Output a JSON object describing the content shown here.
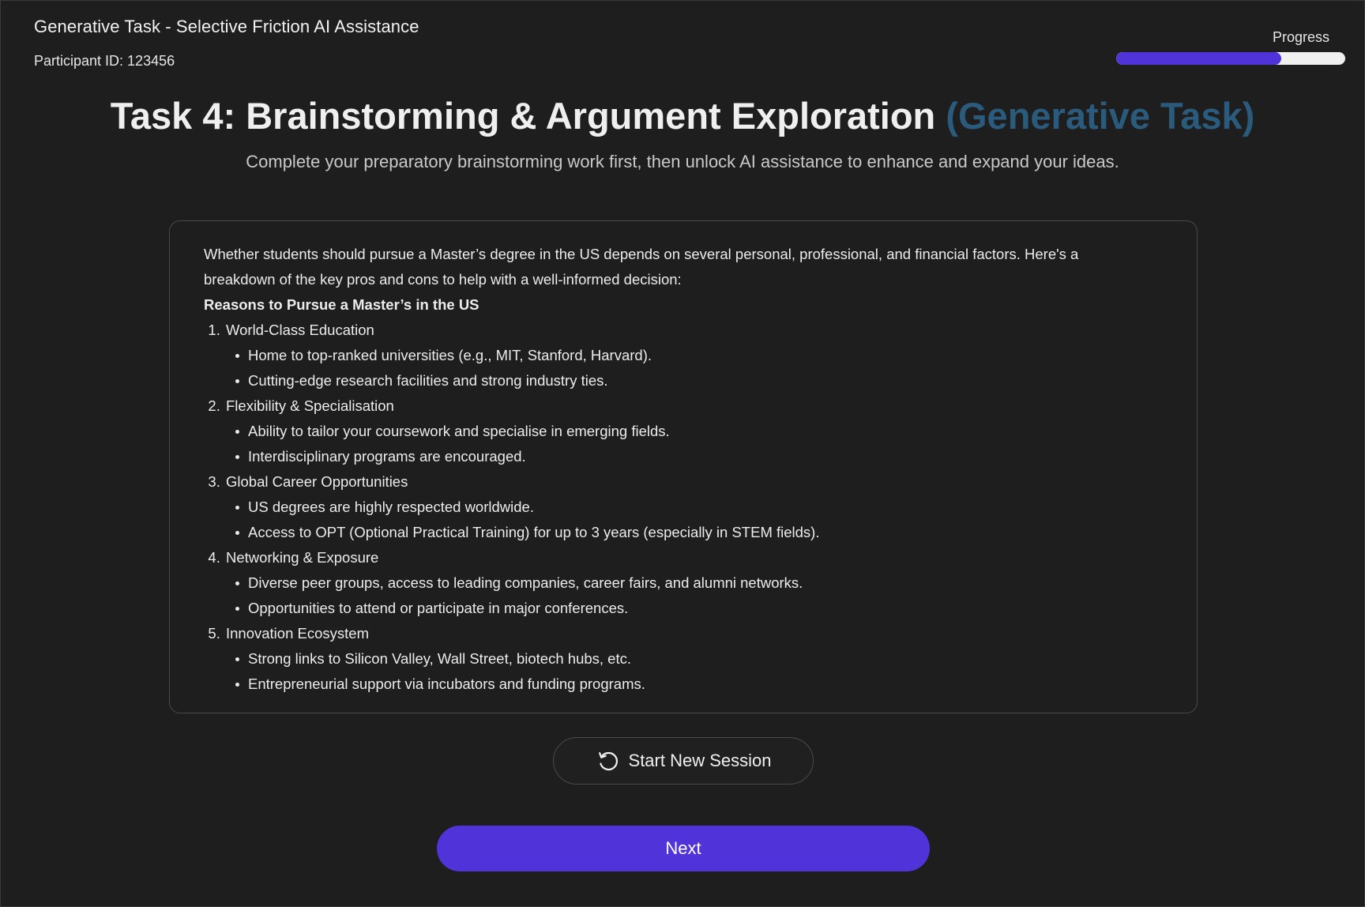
{
  "header": {
    "title": "Generative Task - Selective Friction AI Assistance",
    "participant": "Participant ID: 123456"
  },
  "progress": {
    "label": "Progress",
    "value": 0.72,
    "color": "#5134d9"
  },
  "page": {
    "title_main": "Task 4: Brainstorming & Argument Exploration",
    "title_accent": "(Generative Task)",
    "subtitle": "Complete your preparatory brainstorming work first, then unlock AI assistance to enhance and expand your ideas."
  },
  "response": {
    "intro": "Whether students should pursue a Master’s degree in the US depends on several personal, professional, and financial factors. Here's a breakdown of the key pros and cons to help with a well-informed decision:",
    "heading": "Reasons to Pursue a Master’s in the US",
    "reasons": [
      {
        "title": "World-Class Education",
        "points": [
          "Home to top-ranked universities (e.g., MIT, Stanford, Harvard).",
          "Cutting-edge research facilities and strong industry ties."
        ]
      },
      {
        "title": "Flexibility & Specialisation",
        "points": [
          "Ability to tailor your coursework and specialise in emerging fields.",
          "Interdisciplinary programs are encouraged."
        ]
      },
      {
        "title": "Global Career Opportunities",
        "points": [
          "US degrees are highly respected worldwide.",
          "Access to OPT (Optional Practical Training) for up to 3 years (especially in STEM fields)."
        ]
      },
      {
        "title": "Networking & Exposure",
        "points": [
          "Diverse peer groups, access to leading companies, career fairs, and alumni networks.",
          "Opportunities to attend or participate in major conferences."
        ]
      },
      {
        "title": "Innovation Ecosystem",
        "points": [
          "Strong links to Silicon Valley, Wall Street, biotech hubs, etc.",
          "Entrepreneurial support via incubators and funding programs."
        ]
      }
    ]
  },
  "actions": {
    "new_session_label": "Start New Session",
    "new_session_icon": "refresh-icon",
    "next_label": "Next"
  },
  "colors": {
    "background": "#1e1e1f",
    "accent": "#5134d9",
    "title_accent": "#2b5b7c"
  }
}
